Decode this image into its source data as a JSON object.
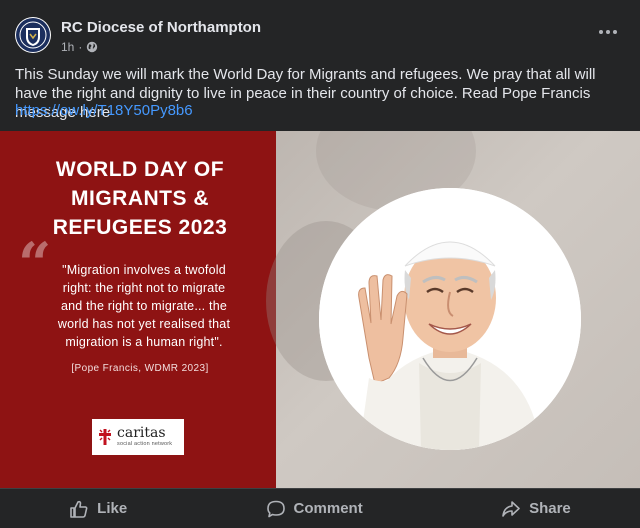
{
  "post": {
    "page_name": "RC Diocese of Northampton",
    "time": "1h",
    "audience_icon": "globe-icon",
    "menu_icon": "more-options-icon",
    "text": "This Sunday we will mark the World Day for Migrants and refugees. We pray that all will have the right and dignity to live in peace in their country of choice. Read Pope Francis message here",
    "link": "https://ow.ly/T18Y50Py8b6"
  },
  "image": {
    "headline_lines": [
      "WORLD DAY OF",
      "MIGRANTS &",
      "REFUGEES 2023"
    ],
    "quote_mark": "“",
    "quote_lines": [
      "\"Migration involves a twofold",
      "right: the right not to migrate",
      "and the right to migrate... the",
      "world has not yet realised that",
      "migration is a human right\"."
    ],
    "attribution": "[Pope Francis, WDMR 2023]",
    "logo": {
      "name": "caritas",
      "subtitle": "social action network"
    }
  },
  "actions": {
    "like": "Like",
    "comment": "Comment",
    "share": "Share"
  },
  "colors": {
    "background": "#242526",
    "link": "#4599ff",
    "banner_red": "#8e1313"
  }
}
